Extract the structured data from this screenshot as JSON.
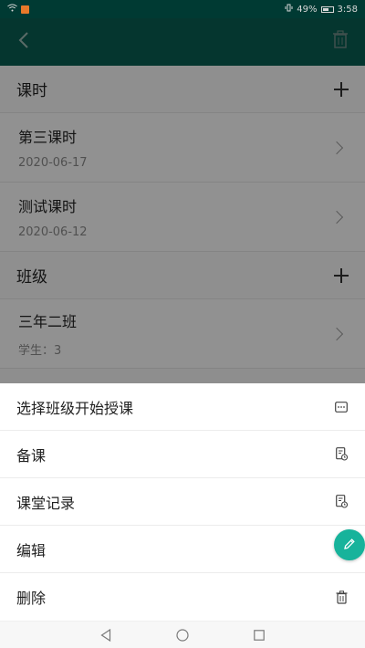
{
  "status_bar": {
    "battery": "49%",
    "time": "3:58"
  },
  "app_bar": {
    "back_icon": "back-arrow-icon",
    "delete_icon": "trash-icon"
  },
  "sections": [
    {
      "title": "课时",
      "rows": [
        {
          "title": "第三课时",
          "subtitle": "2020-06-17"
        },
        {
          "title": "测试课时",
          "subtitle": "2020-06-12"
        }
      ]
    },
    {
      "title": "班级",
      "rows": [
        {
          "title": "三年二班",
          "subtitle": "学生：3"
        }
      ]
    }
  ],
  "sheet": {
    "items": [
      {
        "label": "选择班级开始授课",
        "icon": "more-dots-icon"
      },
      {
        "label": "备课",
        "icon": "document-clock-icon"
      },
      {
        "label": "课堂记录",
        "icon": "document-clock-icon"
      },
      {
        "label": "编辑",
        "icon": "pencil-icon"
      },
      {
        "label": "删除",
        "icon": "trash-icon"
      }
    ]
  },
  "colors": {
    "app_bar": "#0a5d51",
    "accent": "#17b39b"
  }
}
